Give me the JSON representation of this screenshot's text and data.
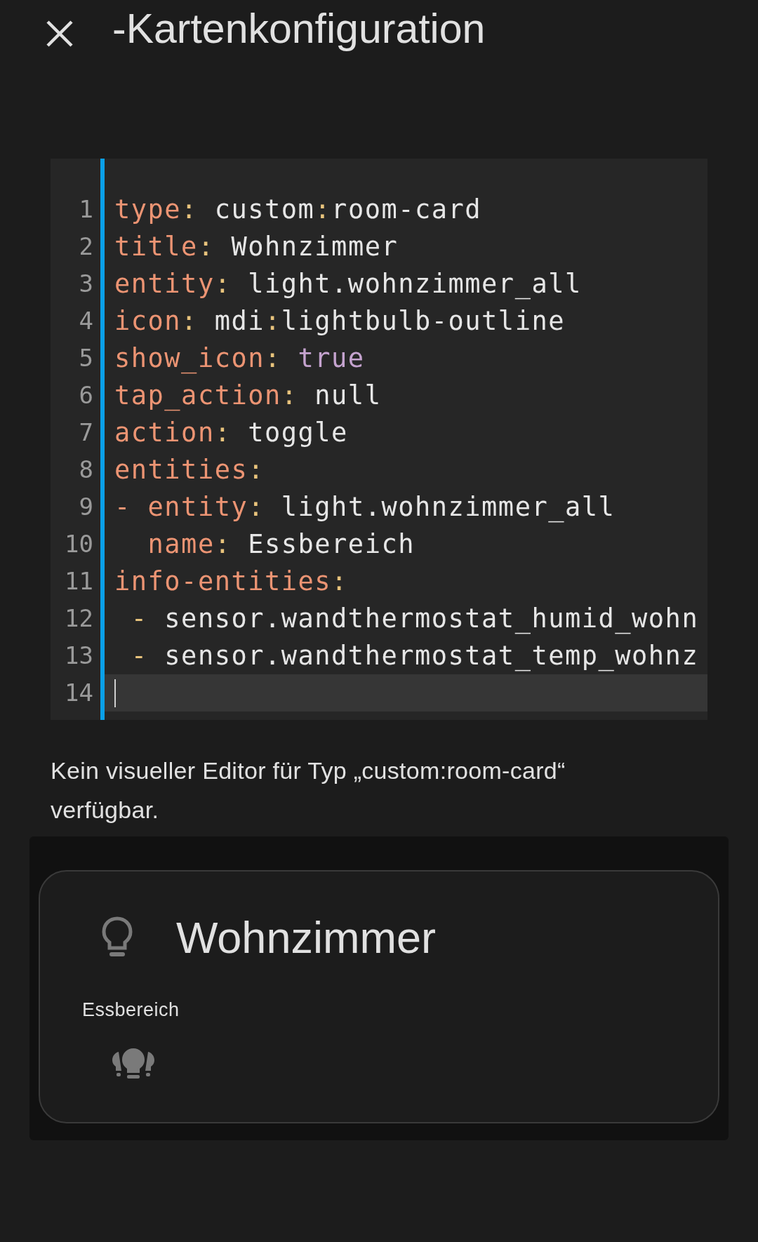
{
  "header": {
    "title": "-Kartenkonfiguration"
  },
  "code": {
    "lines": [
      {
        "number": "1",
        "current": false,
        "tokens": [
          {
            "kind": "key",
            "text": "type"
          },
          {
            "kind": "punct",
            "text": ":"
          },
          {
            "kind": "value",
            "text": " custom"
          },
          {
            "kind": "punct",
            "text": ":"
          },
          {
            "kind": "value",
            "text": "room-card"
          }
        ]
      },
      {
        "number": "2",
        "current": false,
        "tokens": [
          {
            "kind": "key",
            "text": "title"
          },
          {
            "kind": "punct",
            "text": ":"
          },
          {
            "kind": "value",
            "text": " Wohnzimmer"
          }
        ]
      },
      {
        "number": "3",
        "current": false,
        "tokens": [
          {
            "kind": "key",
            "text": "entity"
          },
          {
            "kind": "punct",
            "text": ":"
          },
          {
            "kind": "value",
            "text": " light.wohnzimmer_all"
          }
        ]
      },
      {
        "number": "4",
        "current": false,
        "tokens": [
          {
            "kind": "key",
            "text": "icon"
          },
          {
            "kind": "punct",
            "text": ":"
          },
          {
            "kind": "value",
            "text": " mdi"
          },
          {
            "kind": "punct",
            "text": ":"
          },
          {
            "kind": "value",
            "text": "lightbulb-outline"
          }
        ]
      },
      {
        "number": "5",
        "current": false,
        "tokens": [
          {
            "kind": "key",
            "text": "show_icon"
          },
          {
            "kind": "punct",
            "text": ":"
          },
          {
            "kind": "bool",
            "text": " true"
          }
        ]
      },
      {
        "number": "6",
        "current": false,
        "tokens": [
          {
            "kind": "key",
            "text": "tap_action"
          },
          {
            "kind": "punct",
            "text": ":"
          },
          {
            "kind": "value",
            "text": " null"
          }
        ]
      },
      {
        "number": "7",
        "current": false,
        "tokens": [
          {
            "kind": "key",
            "text": "action"
          },
          {
            "kind": "punct",
            "text": ":"
          },
          {
            "kind": "value",
            "text": " toggle"
          }
        ]
      },
      {
        "number": "8",
        "current": false,
        "tokens": [
          {
            "kind": "key",
            "text": "entities"
          },
          {
            "kind": "punct",
            "text": ":"
          }
        ]
      },
      {
        "number": "9",
        "current": false,
        "tokens": [
          {
            "kind": "key",
            "text": "- entity"
          },
          {
            "kind": "punct",
            "text": ":"
          },
          {
            "kind": "value",
            "text": " light.wohnzimmer_all"
          }
        ]
      },
      {
        "number": "10",
        "current": false,
        "tokens": [
          {
            "kind": "key",
            "text": "  name"
          },
          {
            "kind": "punct",
            "text": ":"
          },
          {
            "kind": "value",
            "text": " Essbereich"
          }
        ]
      },
      {
        "number": "11",
        "current": false,
        "tokens": [
          {
            "kind": "key",
            "text": "info-entities"
          },
          {
            "kind": "punct",
            "text": ":"
          }
        ]
      },
      {
        "number": "12",
        "current": false,
        "tokens": [
          {
            "kind": "punct",
            "text": " -"
          },
          {
            "kind": "value",
            "text": " sensor.wandthermostat_humid_wohn"
          }
        ]
      },
      {
        "number": "13",
        "current": false,
        "tokens": [
          {
            "kind": "punct",
            "text": " -"
          },
          {
            "kind": "value",
            "text": " sensor.wandthermostat_temp_wohnz"
          }
        ]
      },
      {
        "number": "14",
        "current": true
      }
    ]
  },
  "message": "Kein visueller Editor für Typ „custom:room-card“ verfügbar.",
  "preview": {
    "title": "Wohnzimmer",
    "entities": [
      {
        "name": "Essbereich"
      }
    ]
  }
}
